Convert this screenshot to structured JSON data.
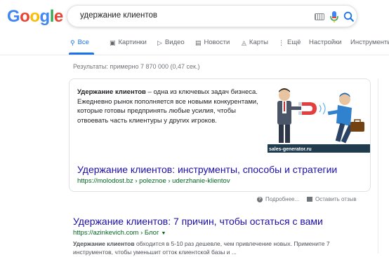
{
  "logo": {
    "letters": [
      "G",
      "o",
      "o",
      "g",
      "l",
      "e"
    ],
    "colors": [
      "#4285F4",
      "#EA4335",
      "#FBBC05",
      "#4285F4",
      "#34A853",
      "#EA4335"
    ]
  },
  "search": {
    "query": "удержание клиентов"
  },
  "tabs": [
    {
      "icon": "search-icon",
      "label": "Все",
      "active": true
    },
    {
      "icon": "image-icon",
      "label": "Картинки"
    },
    {
      "icon": "play-icon",
      "label": "Видео"
    },
    {
      "icon": "news-icon",
      "label": "Новости"
    },
    {
      "icon": "map-icon",
      "label": "Карты"
    },
    {
      "icon": "more-icon",
      "label": "Ещё"
    },
    {
      "label": "Настройки"
    },
    {
      "label": "Инструменты"
    }
  ],
  "results_count": "Результаты: примерно 7 870 000 (0,47 сек.)",
  "featured_snippet": {
    "bold_lead": "Удержание клиентов",
    "text": " – одна из ключевых задач бизнеса. Ежедневно рынок пополняется все новыми конкурентами, которые готовы предпринять любые усилия, чтобы отвоевать часть клиентуры у других игроков.",
    "image_caption": "sales-generator.ru",
    "title": "Удержание клиентов: инструменты, способы и стратегии",
    "url": "https://molodost.bz › poleznoe › uderzhanie-klientov"
  },
  "feedback": {
    "about": "Подробнее...",
    "report": "Оставить отзыв"
  },
  "result2": {
    "title": "Удержание клиентов: 7 причин, чтобы остаться с вами",
    "url": "https://azinkevich.com › Блог",
    "desc_bold": "Удержание клиентов",
    "desc": " обходится в 5-10 раз дешевле, чем привлечение новых. Примените 7 инструментов, чтобы уменьшит отток клиентской базы и ..."
  },
  "colors": {
    "link": "#1a0dab",
    "url": "#006621",
    "accent": "#1a73e8",
    "muted": "#70757a"
  }
}
